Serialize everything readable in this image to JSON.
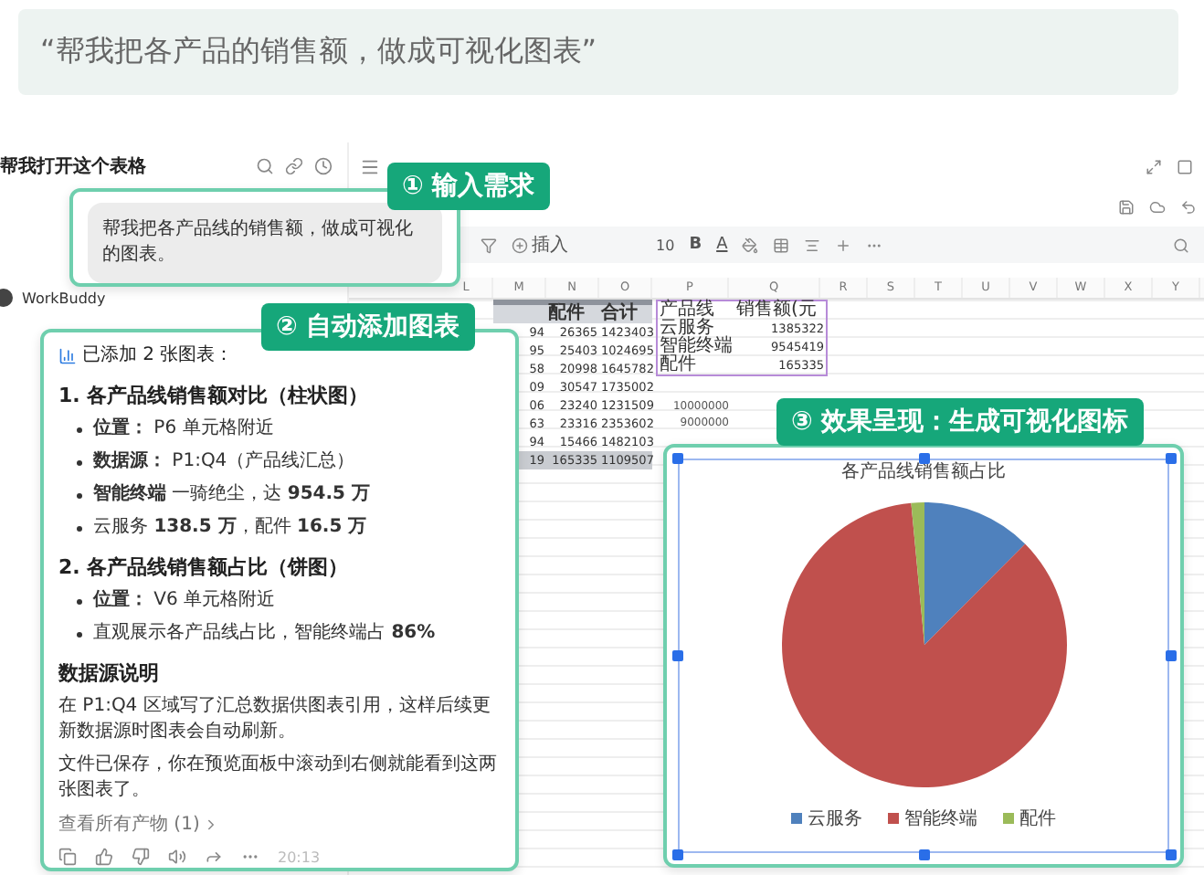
{
  "prompt_quote": "“帮我把各产品的销售额，做成可视化图表”",
  "chat": {
    "title": "帮我打开这个表格",
    "assistant_name": "WorkBuddy",
    "user_message": "帮我把各产品线的销售额，做成可视化的图表。",
    "reply": [
      {
        "kind": "lead",
        "text": "已添加 2 张图表："
      },
      {
        "kind": "heading",
        "text": "1. 各产品线销售额对比（柱状图）"
      },
      {
        "kind": "bullet",
        "text": "**位置：** P6 单元格附近"
      },
      {
        "kind": "bullet",
        "text": "**数据源：** P1:Q4（产品线汇总）"
      },
      {
        "kind": "bullet",
        "text": "**智能终端** 一骑绝尘，达 **954.5 万**"
      },
      {
        "kind": "bullet",
        "text": "云服务 **138.5 万**，配件 **16.5 万**"
      },
      {
        "kind": "heading",
        "text": "2. 各产品线销售额占比（饼图）"
      },
      {
        "kind": "bullet",
        "text": "**位置：** V6 单元格附近"
      },
      {
        "kind": "bullet",
        "text": "直观展示各产品线占比，智能终端占 **86%**"
      },
      {
        "kind": "section",
        "text": "数据源说明"
      },
      {
        "kind": "paragraph",
        "text": "在 P1:Q4 区域写了汇总数据供图表引用，这样后续更新数据源时图表会自动刷新。"
      },
      {
        "kind": "paragraph",
        "text": "文件已保存，你在预览面板中滚动到右侧就能看到这两张图表了。"
      },
      {
        "kind": "link",
        "text": "查看所有产物 (1)"
      }
    ],
    "time": "20:13"
  },
  "sheet": {
    "toolbar": {
      "insert_label": "插入",
      "font_size": "10",
      "bold": "B",
      "font_color": "A"
    },
    "columns": [
      "L",
      "M",
      "N",
      "O",
      "P",
      "Q",
      "R",
      "S",
      "T",
      "U",
      "V",
      "W",
      "X",
      "Y"
    ],
    "data_rows": [
      {
        "kind": "band"
      },
      {
        "kind": "header",
        "cells": [
          "配件",
          "合计"
        ]
      },
      {
        "kind": "data",
        "cells": [
          "94",
          "26365",
          "1423403"
        ]
      },
      {
        "kind": "data",
        "cells": [
          "95",
          "25403",
          "1024695"
        ]
      },
      {
        "kind": "data",
        "cells": [
          "58",
          "20998",
          "1645782"
        ]
      },
      {
        "kind": "data",
        "cells": [
          "09",
          "30547",
          "1735002"
        ]
      },
      {
        "kind": "data",
        "cells": [
          "06",
          "23240",
          "1231509"
        ]
      },
      {
        "kind": "data",
        "cells": [
          "63",
          "23316",
          "2353602"
        ]
      },
      {
        "kind": "data",
        "cells": [
          "94",
          "15466",
          "1482103"
        ]
      },
      {
        "kind": "total",
        "cells": [
          "19",
          "165335",
          "1109507"
        ]
      }
    ],
    "summary_rows": [
      {
        "kind": "header",
        "cells": [
          "产品线",
          "销售额(元"
        ]
      },
      {
        "kind": "data",
        "cells": [
          "云服务",
          "1385322"
        ]
      },
      {
        "kind": "data",
        "cells": [
          "智能终端",
          "9545419"
        ]
      },
      {
        "kind": "data",
        "cells": [
          "配件",
          "165335"
        ]
      }
    ],
    "axis_labels": [
      "10000000",
      "9000000"
    ]
  },
  "chart": {
    "chart_data": {
      "type": "pie",
      "title": "各产品线销售额占比",
      "categories": [
        "云服务",
        "智能终端",
        "配件"
      ],
      "series": [
        {
          "values": [
            12.48,
            86.03,
            1.49
          ]
        }
      ],
      "legend": "bottom"
    },
    "selected": true
  },
  "callouts": [
    {
      "label": "① 输入需求"
    },
    {
      "label": "② 自动添加图表"
    },
    {
      "label": "③ 效果呈现：生成可视化图标"
    }
  ]
}
